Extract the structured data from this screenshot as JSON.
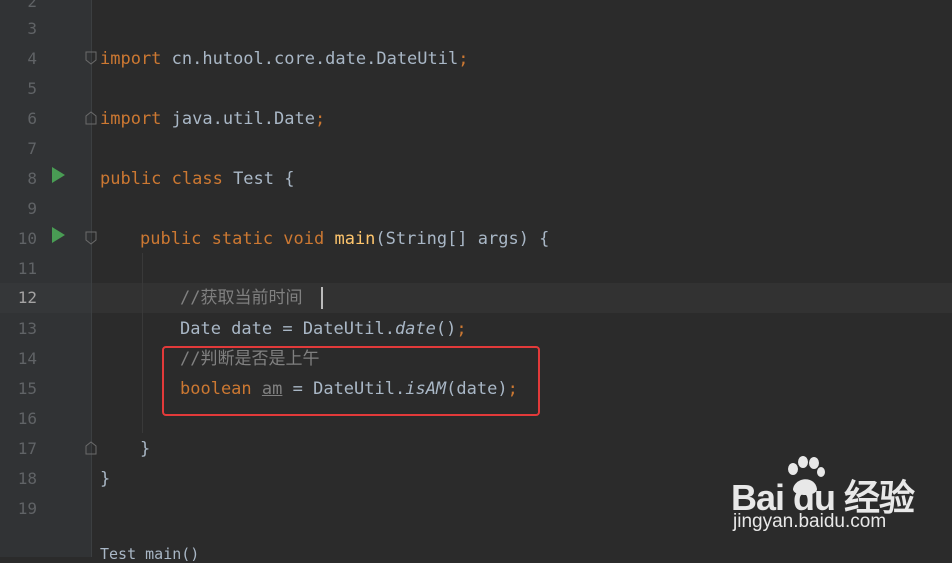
{
  "editor": {
    "line_numbers": [
      "2",
      "3",
      "4",
      "5",
      "6",
      "7",
      "8",
      "9",
      "10",
      "11",
      "12",
      "13",
      "14",
      "15",
      "16",
      "17",
      "18",
      "19"
    ],
    "active_line": "12",
    "lines": {
      "l4": {
        "kw1": "import",
        "text": " cn.hutool.core.date.DateUtil",
        "semi": ";"
      },
      "l6": {
        "kw1": "import",
        "text": " java.util.Date",
        "semi": ";"
      },
      "l8": {
        "kw1": "public class",
        "text": " Test {"
      },
      "l10": {
        "kw1": "public static void",
        "fn": " main",
        "text": "(String[] args) {"
      },
      "l12": {
        "comment": "//获取当前时间"
      },
      "l13": {
        "pre": "Date date = DateUtil.",
        "it": "date",
        "post": "()",
        "semi": ";"
      },
      "l14": {
        "comment": "//判断是否是上午"
      },
      "l15": {
        "kw1": "boolean",
        "unused": "am",
        "pre": " = DateUtil.",
        "it": "isAM",
        "post": "(date)",
        "semi": ";"
      },
      "l17": {
        "text": "}"
      },
      "l18": {
        "text": "}"
      }
    },
    "bottom_partial": "Test  main()"
  },
  "watermark": {
    "brand": "Bai  du 经验",
    "url": "jingyan.baidu.com"
  },
  "colors": {
    "keyword": "#cc7832",
    "comment": "#808080",
    "text": "#a9b7c6",
    "highlight_box": "#e23a3a",
    "run_icon": "#499c54"
  }
}
